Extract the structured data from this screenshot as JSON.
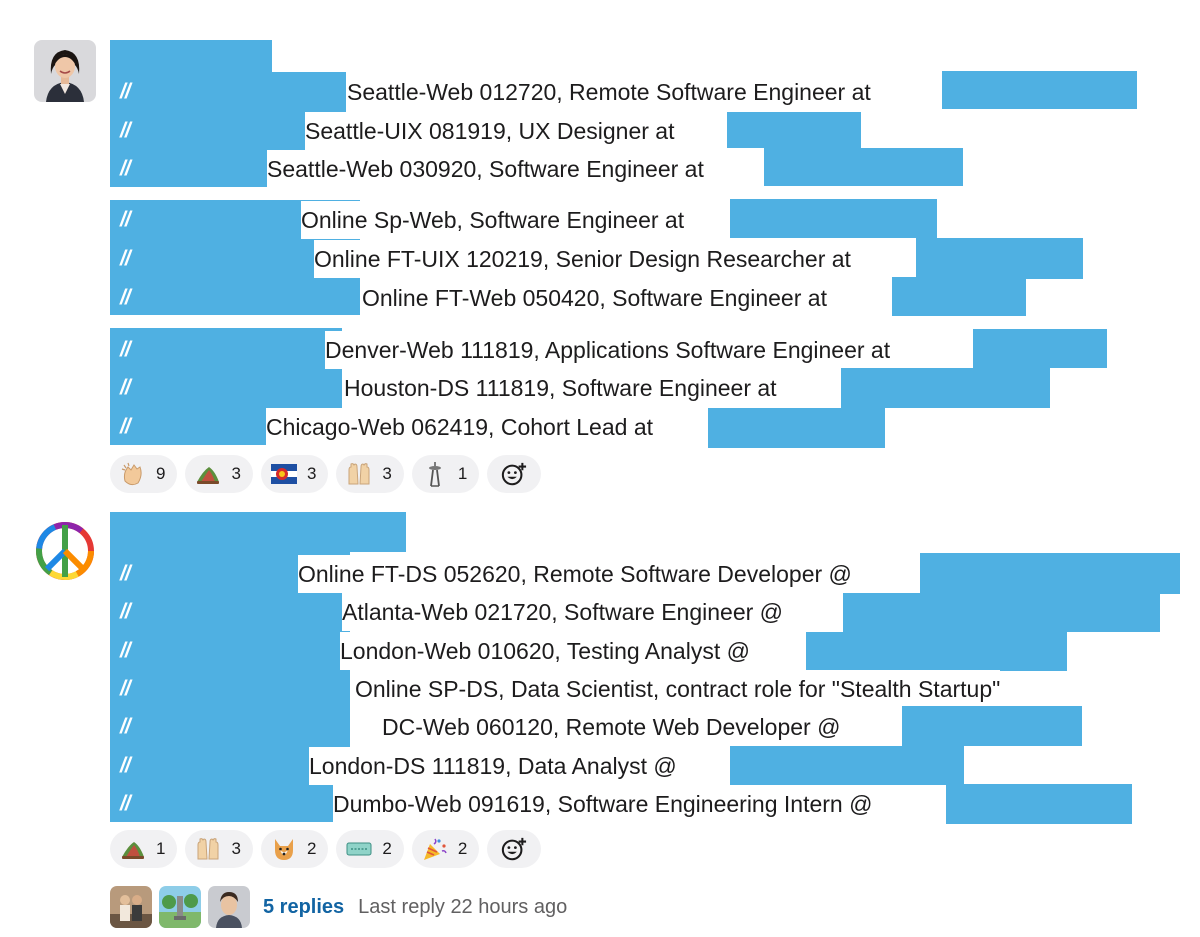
{
  "messages": [
    {
      "lines": [
        "Seattle-Web 012720, Remote Software Engineer at",
        "Seattle-UIX 081919, UX Designer at",
        "Seattle-Web 030920, Software Engineer at",
        "Online Sp-Web, Software Engineer at",
        "Online FT-UIX 120219, Senior Design Researcher at",
        "Online FT-Web 050420, Software Engineer at",
        "Denver-Web 111819, Applications Software Engineer at",
        "Houston-DS 111819, Software Engineer at",
        "Chicago-Web 062419, Cohort Lead at"
      ],
      "reactions": [
        {
          "emoji": "clapping-hands",
          "count": "9"
        },
        {
          "emoji": "leaf-hat",
          "count": "3"
        },
        {
          "emoji": "colorado-flag",
          "count": "3"
        },
        {
          "emoji": "raised-hands",
          "count": "3"
        },
        {
          "emoji": "space-needle",
          "count": "1"
        }
      ]
    },
    {
      "lines": [
        "Online FT-DS 052620, Remote Software Developer @",
        "Atlanta-Web 021720, Software Engineer @",
        "London-Web 010620, Testing Analyst @",
        "Online SP-DS, Data Scientist, contract role for \"Stealth Startup\"",
        "DC-Web 060120, Remote Web Developer @",
        "London-DS 111819, Data Analyst @",
        "Dumbo-Web 091619, Software Engineering Intern @"
      ],
      "reactions": [
        {
          "emoji": "leaf-hat",
          "count": "1"
        },
        {
          "emoji": "raised-hands",
          "count": "3"
        },
        {
          "emoji": "corgi",
          "count": "2"
        },
        {
          "emoji": "ticket",
          "count": "2"
        },
        {
          "emoji": "party-popper",
          "count": "2"
        }
      ]
    }
  ],
  "slash": "//",
  "thread": {
    "replies": "5 replies",
    "last_reply": "Last reply 22 hours ago"
  },
  "colors": {
    "redaction": "#4fb0e2",
    "link": "#1264a3"
  }
}
